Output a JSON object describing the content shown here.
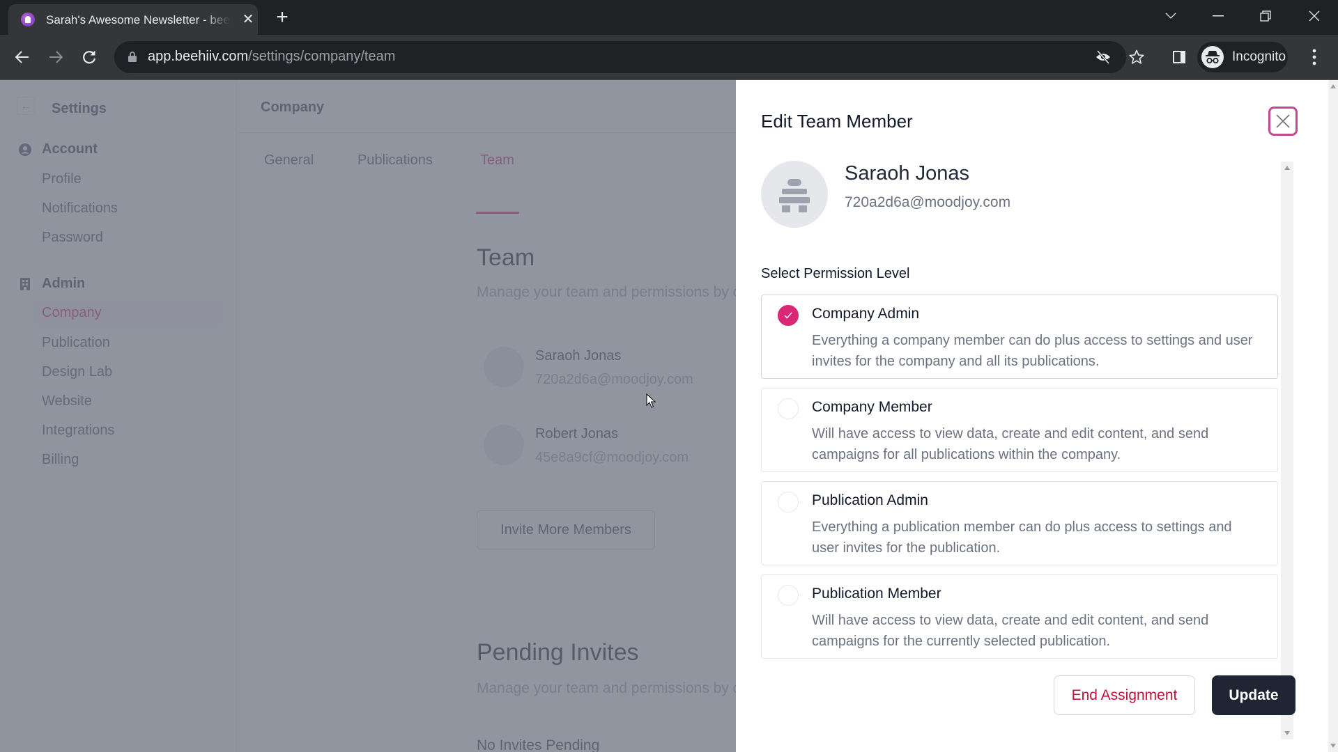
{
  "browser": {
    "tab_title": "Sarah's Awesome Newsletter - beehiiv",
    "url_domain": "app.beehiiv.com",
    "url_path": "/settings/company/team",
    "profile_label": "Incognito",
    "icons": [
      "favicon-beehiiv",
      "close-icon",
      "plus-icon",
      "chevron-down-icon",
      "minimize-icon",
      "restore-icon",
      "window-close-icon",
      "back-arrow-icon",
      "forward-arrow-icon",
      "reload-icon",
      "lock-icon",
      "eye-slash-icon",
      "star-icon",
      "side-panel-icon",
      "incognito-icon",
      "kebab-menu-icon"
    ]
  },
  "sidebar": {
    "title": "Settings",
    "sections": [
      {
        "label": "Account",
        "icon": "user-circle-icon",
        "items": [
          "Profile",
          "Notifications",
          "Password"
        ]
      },
      {
        "label": "Admin",
        "icon": "building-icon",
        "items": [
          "Company",
          "Publication",
          "Design Lab",
          "Website",
          "Integrations",
          "Billing"
        ]
      }
    ],
    "active_item": "Company"
  },
  "main": {
    "header": "Company",
    "tabs": [
      {
        "label": "General",
        "active": false
      },
      {
        "label": "Publications",
        "active": false
      },
      {
        "label": "Team",
        "active": true
      }
    ],
    "team": {
      "title": "Team",
      "subtitle": "Manage your team and permissions by company",
      "members": [
        {
          "name": "Saraoh Jonas",
          "email": "720a2d6a@moodjoy.com"
        },
        {
          "name": "Robert Jonas",
          "email": "45e8a9cf@moodjoy.com"
        }
      ],
      "invite_button": "Invite More Members"
    },
    "pending": {
      "title": "Pending Invites",
      "subtitle": "Manage your team and permissions by company",
      "empty_text": "No Invites Pending"
    }
  },
  "drawer": {
    "title": "Edit Team Member",
    "member": {
      "name": "Saraoh Jonas",
      "email": "720a2d6a@moodjoy.com"
    },
    "permission_label": "Select Permission Level",
    "options": [
      {
        "title": "Company Admin",
        "description": "Everything a company member can do plus access to settings and user invites for the company and all its publications.",
        "selected": true
      },
      {
        "title": "Company Member",
        "description": "Will have access to view data, create and edit content, and send campaigns for all publications within the company.",
        "selected": false
      },
      {
        "title": "Publication Admin",
        "description": "Everything a publication member can do plus access to settings and user invites for the publication.",
        "selected": false
      },
      {
        "title": "Publication Member",
        "description": "Will have access to view data, create and edit content, and send campaigns for the currently selected publication.",
        "selected": false
      }
    ],
    "end_button": "End Assignment",
    "update_button": "Update"
  },
  "colors": {
    "accent": "#db2777",
    "danger": "#be123c",
    "primary_button": "#1f2532",
    "close_border": "#be4b8f"
  }
}
